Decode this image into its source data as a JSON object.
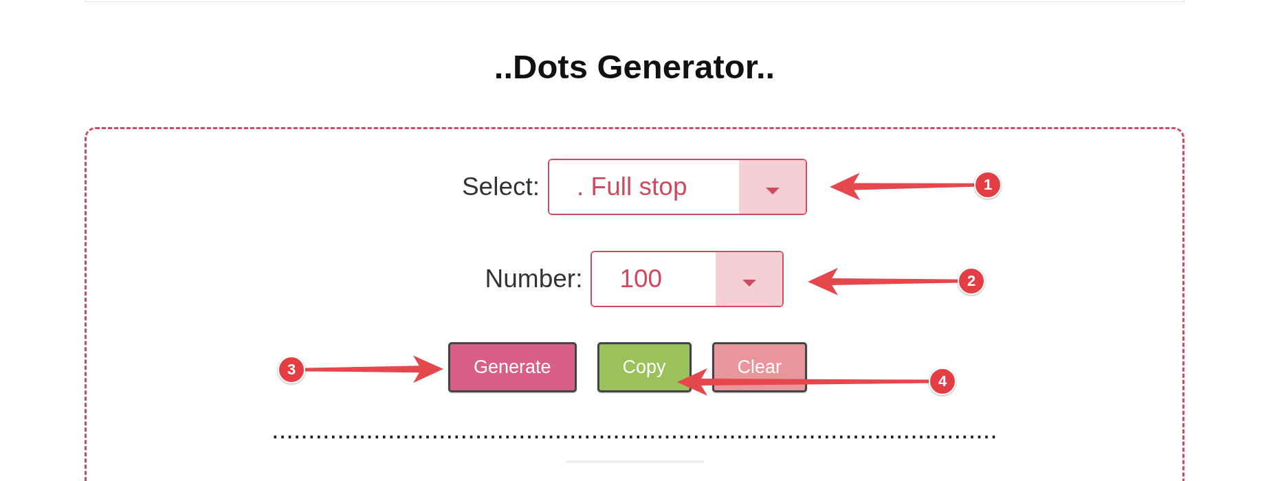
{
  "title": "..Dots Generator..",
  "fields": [
    {
      "label": "Select:",
      "value": ". Full stop"
    },
    {
      "label": "Number:",
      "value": "100"
    }
  ],
  "buttons": [
    {
      "label": "Generate",
      "color": "#d95f86"
    },
    {
      "label": "Copy",
      "color": "#9bc25a"
    },
    {
      "label": "Clear",
      "color": "#e8959b"
    }
  ],
  "output": "....................................................................................................",
  "annotations": [
    {
      "number": "1"
    },
    {
      "number": "2"
    },
    {
      "number": "3"
    },
    {
      "number": "4"
    }
  ]
}
